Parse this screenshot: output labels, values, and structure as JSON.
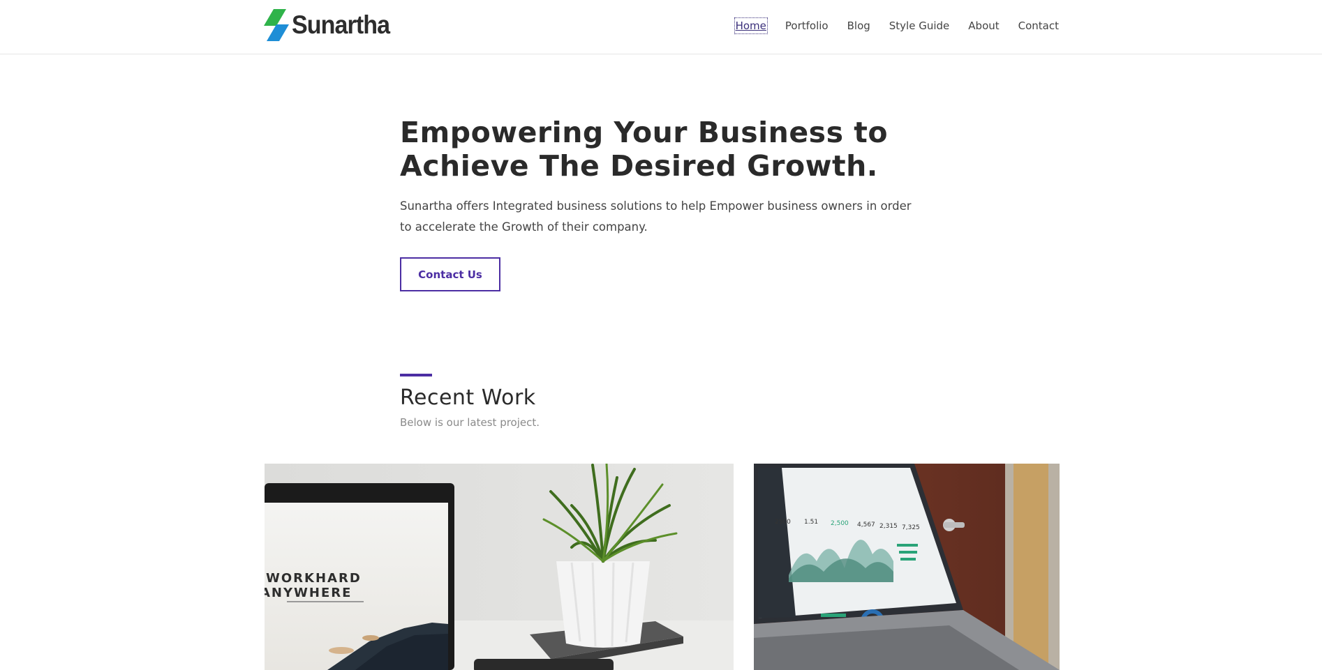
{
  "site": {
    "logo_text": "Sunartha",
    "colors": {
      "accent": "#4c2ea3",
      "logo_green": "#2fb34a",
      "logo_blue": "#1e8ed6"
    }
  },
  "nav": {
    "items": [
      {
        "label": "Home",
        "active": true
      },
      {
        "label": "Portfolio"
      },
      {
        "label": "Blog"
      },
      {
        "label": "Style Guide"
      },
      {
        "label": "About"
      },
      {
        "label": "Contact"
      }
    ]
  },
  "hero": {
    "title_line1": "Empowering Your Business to",
    "title_line2": "Achieve The Desired Growth.",
    "description": "Sunartha offers Integrated business solutions to help Empower business owners in order to accelerate the Growth of their company.",
    "cta_label": "Contact Us"
  },
  "recent_work": {
    "title": "Recent Work",
    "subtitle": "Below is our latest project.",
    "projects": [
      {
        "image": "laptop-plant-photo",
        "screen_text_line1": "WORKHARD",
        "screen_text_line2": "ANYWHERE"
      },
      {
        "image": "laptop-dashboard-photo",
        "stats": [
          "2500",
          "1.51",
          "2,500",
          "4,567",
          "2,315",
          "7,325"
        ]
      }
    ]
  }
}
